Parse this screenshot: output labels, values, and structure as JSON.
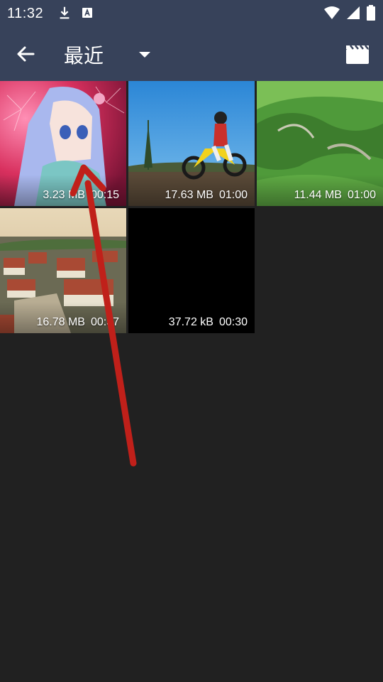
{
  "status_bar": {
    "time": "11:32"
  },
  "header": {
    "title": "最近"
  },
  "videos": [
    {
      "size": "3.23 MB",
      "duration": "00:15",
      "thumbnail": "anime-girl-fireworks"
    },
    {
      "size": "17.63 MB",
      "duration": "01:00",
      "thumbnail": "motocross-rider"
    },
    {
      "size": "11.44 MB",
      "duration": "01:00",
      "thumbnail": "green-mountains"
    },
    {
      "size": "16.78 MB",
      "duration": "00:37",
      "thumbnail": "old-town-aerial"
    },
    {
      "size": "37.72 kB",
      "duration": "00:30",
      "thumbnail": "black-frame"
    }
  ],
  "colors": {
    "app_bar": "#37425a",
    "background": "#212121",
    "annotation_arrow": "#c0201a"
  }
}
